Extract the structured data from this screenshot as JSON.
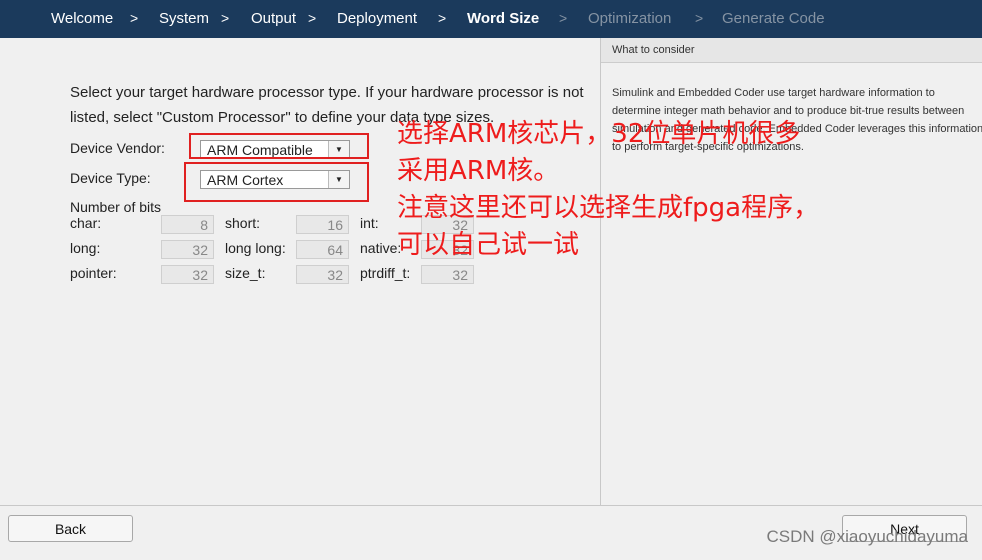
{
  "nav": {
    "steps": [
      "Welcome",
      "System",
      "Output",
      "Deployment",
      "Word Size",
      "Optimization",
      "Generate Code"
    ],
    "separator": ">"
  },
  "main": {
    "intro": "Select your target hardware processor type. If your hardware processor is not listed, select \"Custom Processor\" to define your data type sizes.",
    "device_vendor_label": "Device Vendor:",
    "device_vendor_value": "ARM Compatible",
    "device_type_label": "Device Type:",
    "device_type_value": "ARM Cortex",
    "bits_title": "Number of bits",
    "bits": {
      "char_label": "char:",
      "char": "8",
      "short_label": "short:",
      "short": "16",
      "int_label": "int:",
      "int": "32",
      "long_label": "long:",
      "long": "32",
      "long_long_label": "long long:",
      "long_long": "64",
      "native_label": "native:",
      "native": "32",
      "pointer_label": "pointer:",
      "pointer": "32",
      "size_t_label": "size_t:",
      "size_t": "32",
      "ptrdiff_t_label": "ptrdiff_t:",
      "ptrdiff_t": "32"
    }
  },
  "side": {
    "header": "What to consider",
    "body": "Simulink and Embedded Coder use target hardware information to determine integer math behavior and to produce bit-true results between simulation and generated code. Embedded Coder leverages this information to perform target-specific optimizations."
  },
  "annotation": {
    "line1": "选择ARM核芯片，32位单片机很多",
    "line2": "采用ARM核。",
    "line3": "注意这里还可以选择生成fpga程序，",
    "line4": "可以自己试一试",
    "color": "#ee1c1c"
  },
  "footer": {
    "back_label": "Back",
    "next_label": "Next",
    "watermark": "CSDN @xiaoyuchidayuma"
  },
  "icons": {
    "dropdown": "chevron-down-icon"
  },
  "colors": {
    "nav_bg": "#1b3a5c",
    "highlight": "#e02020"
  }
}
